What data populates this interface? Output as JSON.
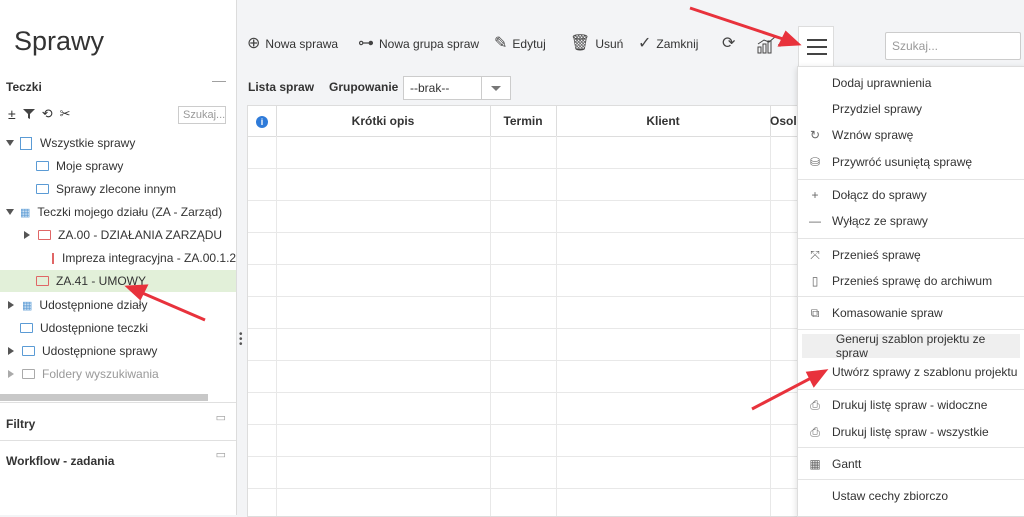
{
  "app": {
    "title": "Sprawy"
  },
  "left": {
    "teczki": "Teczki",
    "search_placeholder": "Szukaj...",
    "tree": [
      "Wszystkie sprawy",
      "Moje sprawy",
      "Sprawy zlecone innym",
      "Teczki mojego działu (ZA - Zarząd)",
      "ZA.00 - DZIAŁANIA ZARZĄDU",
      "Impreza integracyjna - ZA.00.1.2",
      "ZA.41 - UMOWY",
      "Udostępnione działy",
      "Udostępnione teczki",
      "Udostępnione sprawy",
      "Foldery wyszukiwania"
    ],
    "filtry": "Filtry",
    "workflow": "Workflow - zadania"
  },
  "toolbar": {
    "nowa_sprawa": "Nowa sprawa",
    "nowa_grupa": "Nowa grupa spraw",
    "edytuj": "Edytuj",
    "usun": "Usuń",
    "zamknij": "Zamknij",
    "search_placeholder": "Szukaj..."
  },
  "list": {
    "label": "Lista spraw",
    "grouping_label": "Grupowanie",
    "grouping_value": "--brak--",
    "columns": [
      "Krótki opis",
      "Termin",
      "Klient",
      "Osol"
    ]
  },
  "menu": {
    "items": [
      "Dodaj uprawnienia",
      "Przydziel sprawy",
      "Wznów sprawę",
      "Przywróć usuniętą sprawę",
      "Dołącz do sprawy",
      "Wyłącz ze sprawy",
      "Przenieś sprawę",
      "Przenieś sprawę do archiwum",
      "Komasowanie spraw",
      "Generuj szablon projektu ze spraw",
      "Utwórz sprawy z szablonu projektu",
      "Drukuj listę spraw - widoczne",
      "Drukuj listę spraw - wszystkie",
      "Gantt",
      "Ustaw cechy zbiorczo"
    ]
  },
  "colors": {
    "annotation_arrow": "#e8323c",
    "selected_row": "#e2f0d9",
    "folder_blue": "#5b9bd5",
    "folder_red": "#e06666"
  }
}
